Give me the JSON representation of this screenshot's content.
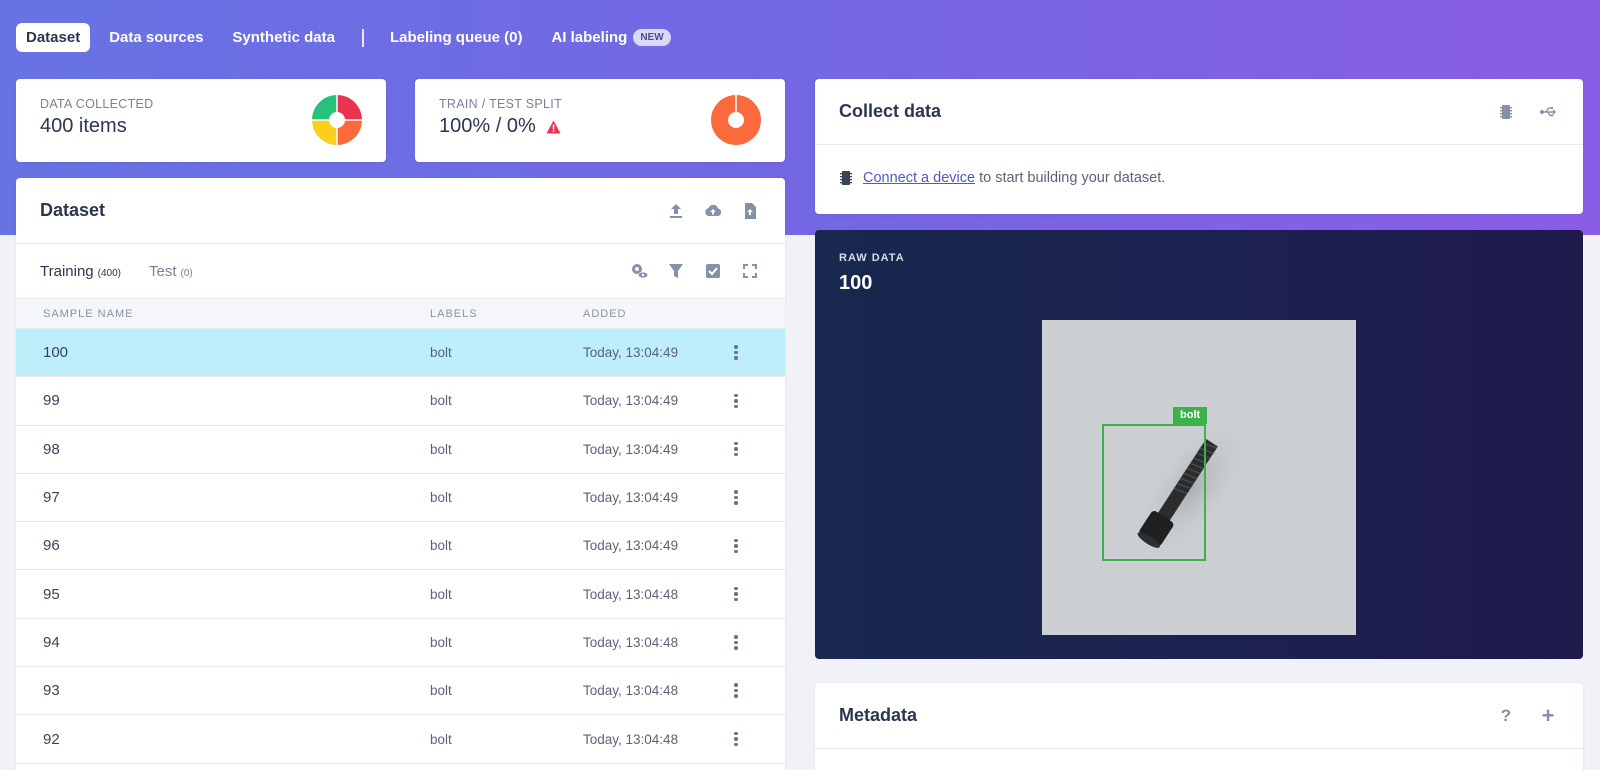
{
  "nav": {
    "tabs": [
      {
        "label": "Dataset"
      },
      {
        "label": "Data sources"
      },
      {
        "label": "Synthetic data"
      },
      {
        "label": "Labeling queue (0)"
      },
      {
        "label": "AI labeling",
        "badge": "NEW"
      }
    ],
    "active": "Dataset"
  },
  "stats": {
    "collected": {
      "label": "DATA COLLECTED",
      "value": "400 items"
    },
    "split": {
      "label": "TRAIN / TEST SPLIT",
      "value": "100% / 0%"
    }
  },
  "dataset": {
    "title": "Dataset",
    "tabs": [
      {
        "label": "Training",
        "count": "(400)"
      },
      {
        "label": "Test",
        "count": "(0)"
      }
    ],
    "columns": {
      "name": "SAMPLE NAME",
      "labels": "LABELS",
      "added": "ADDED"
    },
    "rows": [
      {
        "name": "100",
        "label": "bolt",
        "added": "Today, 13:04:49"
      },
      {
        "name": "99",
        "label": "bolt",
        "added": "Today, 13:04:49"
      },
      {
        "name": "98",
        "label": "bolt",
        "added": "Today, 13:04:49"
      },
      {
        "name": "97",
        "label": "bolt",
        "added": "Today, 13:04:49"
      },
      {
        "name": "96",
        "label": "bolt",
        "added": "Today, 13:04:49"
      },
      {
        "name": "95",
        "label": "bolt",
        "added": "Today, 13:04:48"
      },
      {
        "name": "94",
        "label": "bolt",
        "added": "Today, 13:04:48"
      },
      {
        "name": "93",
        "label": "bolt",
        "added": "Today, 13:04:48"
      },
      {
        "name": "92",
        "label": "bolt",
        "added": "Today, 13:04:48"
      }
    ]
  },
  "collect": {
    "title": "Collect data",
    "link": "Connect a device",
    "rest": " to start building your dataset."
  },
  "raw": {
    "label": "RAW DATA",
    "value": "100",
    "bbox_label": "bolt"
  },
  "metadata": {
    "title": "Metadata"
  },
  "colors": {
    "accent": "#6c6de5",
    "selected_row": "#bdeefa",
    "bbox": "#3bb34a",
    "warning": "#e8344e"
  }
}
